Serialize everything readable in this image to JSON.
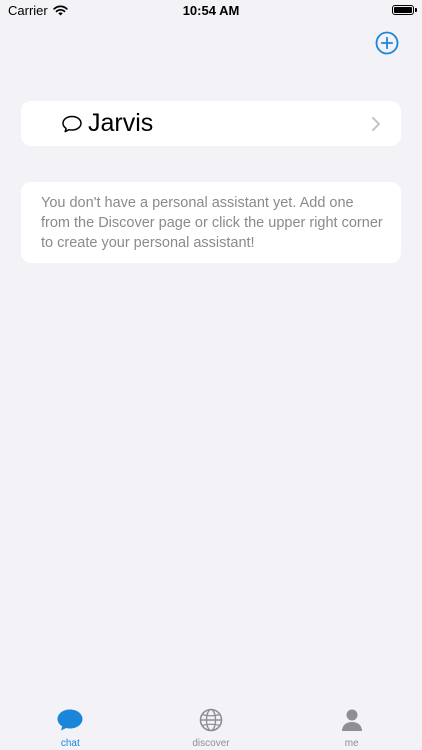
{
  "status_bar": {
    "carrier": "Carrier",
    "time": "10:54 AM"
  },
  "header": {
    "add_icon": "plus-circle-icon"
  },
  "assistants": [
    {
      "name": "Jarvis",
      "icon": "chat-bubble-icon"
    }
  ],
  "info": {
    "message": "You don't have a personal assistant yet. Add one from the Discover page or click the upper right corner to create your personal assistant!"
  },
  "tab_bar": {
    "tabs": [
      {
        "label": "chat",
        "icon": "chat-bubble-fill-icon",
        "active": true
      },
      {
        "label": "discover",
        "icon": "globe-icon",
        "active": false
      },
      {
        "label": "me",
        "icon": "person-icon",
        "active": false
      }
    ]
  },
  "colors": {
    "accent": "#1a86d9",
    "background": "#f2f2f7",
    "inactive": "#8e8e93"
  }
}
